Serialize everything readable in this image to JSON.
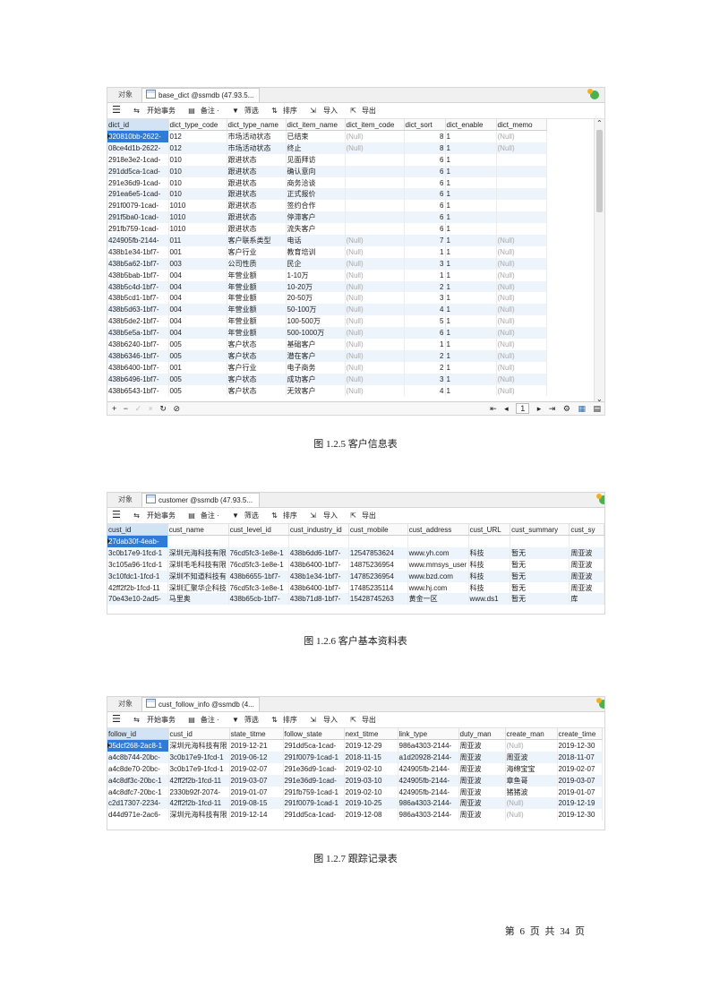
{
  "common": {
    "tab_object": "对象",
    "toolbar": {
      "begin": "开始事务",
      "memo": "备注 ·",
      "filter": "筛选",
      "sort": "排序",
      "import": "导入",
      "export": "导出"
    },
    "null_text": "(Null)"
  },
  "shot1": {
    "tab_title": "base_dict @ssmdb (47.93.5...",
    "columns": [
      "dict_id",
      "dict_type_code",
      "dict_type_name",
      "dict_item_name",
      "dict_item_code",
      "dict_sort",
      "dict_enable",
      "dict_memo"
    ],
    "rows": [
      [
        "020810bb-2622-",
        "012",
        "市场活动状态",
        "已结束",
        "(Null)",
        "8",
        "1",
        "(Null)"
      ],
      [
        "08ce4d1b-2622-",
        "012",
        "市场活动状态",
        "终止",
        "(Null)",
        "8",
        "1",
        "(Null)"
      ],
      [
        "2918e3e2-1cad-",
        "010",
        "跟进状态",
        "见面拜访",
        "",
        "6",
        "1",
        ""
      ],
      [
        "291dd5ca-1cad-",
        "010",
        "跟进状态",
        "确认意向",
        "",
        "6",
        "1",
        ""
      ],
      [
        "291e36d9-1cad-",
        "010",
        "跟进状态",
        "商务洽谈",
        "",
        "6",
        "1",
        ""
      ],
      [
        "291ea6e5-1cad-",
        "010",
        "跟进状态",
        "正式报价",
        "",
        "6",
        "1",
        ""
      ],
      [
        "291f0079-1cad-",
        "1010",
        "跟进状态",
        "签约合作",
        "",
        "6",
        "1",
        ""
      ],
      [
        "291f5ba0-1cad-",
        "1010",
        "跟进状态",
        "停滞客户",
        "",
        "6",
        "1",
        ""
      ],
      [
        "291fb759-1cad-",
        "1010",
        "跟进状态",
        "流失客户",
        "",
        "6",
        "1",
        ""
      ],
      [
        "424905fb-2144-",
        "011",
        "客户联系类型",
        "电话",
        "(Null)",
        "7",
        "1",
        "(Null)"
      ],
      [
        "438b1e34-1bf7-",
        "001",
        "客户行业",
        "教育培训",
        "(Null)",
        "1",
        "1",
        "(Null)"
      ],
      [
        "438b5a62-1bf7-",
        "003",
        "公司性质",
        "民企",
        "(Null)",
        "3",
        "1",
        "(Null)"
      ],
      [
        "438b5bab-1bf7-",
        "004",
        "年营业额",
        "1-10万",
        "(Null)",
        "1",
        "1",
        "(Null)"
      ],
      [
        "438b5c4d-1bf7-",
        "004",
        "年营业额",
        "10-20万",
        "(Null)",
        "2",
        "1",
        "(Null)"
      ],
      [
        "438b5cd1-1bf7-",
        "004",
        "年营业额",
        "20-50万",
        "(Null)",
        "3",
        "1",
        "(Null)"
      ],
      [
        "438b5d63-1bf7-",
        "004",
        "年营业额",
        "50-100万",
        "(Null)",
        "4",
        "1",
        "(Null)"
      ],
      [
        "438b5de2-1bf7-",
        "004",
        "年营业额",
        "100-500万",
        "(Null)",
        "5",
        "1",
        "(Null)"
      ],
      [
        "438b5e5a-1bf7-",
        "004",
        "年营业额",
        "500-1000万",
        "(Null)",
        "6",
        "1",
        "(Null)"
      ],
      [
        "438b6240-1bf7-",
        "005",
        "客户状态",
        "基础客户",
        "(Null)",
        "1",
        "1",
        "(Null)"
      ],
      [
        "438b6346-1bf7-",
        "005",
        "客户状态",
        "潜在客户",
        "(Null)",
        "2",
        "1",
        "(Null)"
      ],
      [
        "438b6400-1bf7-",
        "001",
        "客户行业",
        "电子商务",
        "(Null)",
        "2",
        "1",
        "(Null)"
      ],
      [
        "438b6496-1bf7-",
        "005",
        "客户状态",
        "成功客户",
        "(Null)",
        "3",
        "1",
        "(Null)"
      ],
      [
        "438b6543-1bf7-",
        "005",
        "客户状态",
        "无效客户",
        "(Null)",
        "4",
        "1",
        "(Null)"
      ]
    ],
    "page_number": "1",
    "caption": "图 1.2.5 客户信息表"
  },
  "shot2": {
    "tab_title": "customer @ssmdb (47.93.5...",
    "columns": [
      "cust_id",
      "cust_name",
      "cust_level_id",
      "cust_industry_id",
      "cust_mobile",
      "cust_address",
      "cust_URL",
      "cust_summary",
      "cust_sy"
    ],
    "rows": [
      [
        "27dab30f-4eab-",
        "",
        "",
        "",
        "",
        "",
        "",
        "",
        ""
      ],
      [
        "3c0b17e9-1fcd-1",
        "深圳元海科技有限",
        "76cd5fc3-1e8e-1",
        "438b6dd6-1bf7-",
        "12547853624",
        "www.yh.com",
        "科技",
        "暂无",
        "周亚波"
      ],
      [
        "3c105a96-1fcd-1",
        "深圳毛毛科技有限",
        "76cd5fc3-1e8e-1",
        "438b6400-1bf7-",
        "14875236954",
        "www.mmsys_user",
        "科技",
        "暂无",
        "周亚波"
      ],
      [
        "3c10fdc1-1fcd-1",
        "深圳不知道科技有",
        "438b6655-1bf7-",
        "438b1e34-1bf7-",
        "14785236954",
        "www.bzd.com",
        "科技",
        "暂无",
        "周亚波"
      ],
      [
        "42ff2f2b-1fcd-11",
        "深圳汇聚华企科技",
        "76cd5fc3-1e8e-1",
        "438b6400-1bf7-",
        "17485235114",
        "www.hj.com",
        "科技",
        "暂无",
        "周亚波"
      ],
      [
        "70e43e10-2ad5-",
        "马里奥",
        "438b65cb-1bf7-",
        "438b71d8-1bf7-",
        "15428745263",
        "黄金一区",
        "www.ds1",
        "暂无",
        "库"
      ]
    ],
    "caption": "图 1.2.6 客户基本资料表"
  },
  "shot3": {
    "tab_title": "cust_follow_info @ssmdb (4...",
    "columns": [
      "follow_id",
      "cust_id",
      "state_titme",
      "follow_state",
      "next_titme",
      "link_type",
      "duty_man",
      "create_man",
      "create_time"
    ],
    "rows": [
      [
        "05dcf268-2ac8-1",
        "深圳元海科技有限",
        "2019-12-21",
        "291dd5ca-1cad-",
        "2019-12-29",
        "986a4303-2144-",
        "周亚波",
        "(Null)",
        "2019-12-30"
      ],
      [
        "a4c8b744-20bc-",
        "3c0b17e9-1fcd-1",
        "2019-06-12",
        "291f0079-1cad-1",
        "2018-11-15",
        "a1d20928-2144-",
        "周亚波",
        "周亚波",
        "2018-11-07"
      ],
      [
        "a4c8de70-20bc-",
        "3c0b17e9-1fcd-1",
        "2019-02-07",
        "291e36d9-1cad-",
        "2019-02-10",
        "424905fb-2144-",
        "周亚波",
        "海绵宝宝",
        "2019-02-07"
      ],
      [
        "a4c8df3c-20bc-1",
        "42ff2f2b-1fcd-11",
        "2019-03-07",
        "291e36d9-1cad-",
        "2019-03-10",
        "424905fb-2144-",
        "周亚波",
        "章鱼哥",
        "2019-03-07"
      ],
      [
        "a4c8dfc7-20bc-1",
        "2330b92f-2074-",
        "2019-01-07",
        "291fb759-1cad-1",
        "2019-02-10",
        "424905fb-2144-",
        "周亚波",
        "猪猪波",
        "2019-01-07"
      ],
      [
        "c2d17307-2234-",
        "42ff2f2b-1fcd-11",
        "2019-08-15",
        "291f0079-1cad-1",
        "2019-10-25",
        "986a4303-2144-",
        "周亚波",
        "(Null)",
        "2019-12-19"
      ],
      [
        "d44d971e-2ac6-",
        "深圳元海科技有限",
        "2019-12-14",
        "291dd5ca-1cad-",
        "2019-12-08",
        "986a4303-2144-",
        "周亚波",
        "(Null)",
        "2019-12-30"
      ]
    ],
    "caption": "图 1.2.7 跟踪记录表"
  },
  "footer": {
    "page_label": "第 6 页 共 34 页"
  }
}
